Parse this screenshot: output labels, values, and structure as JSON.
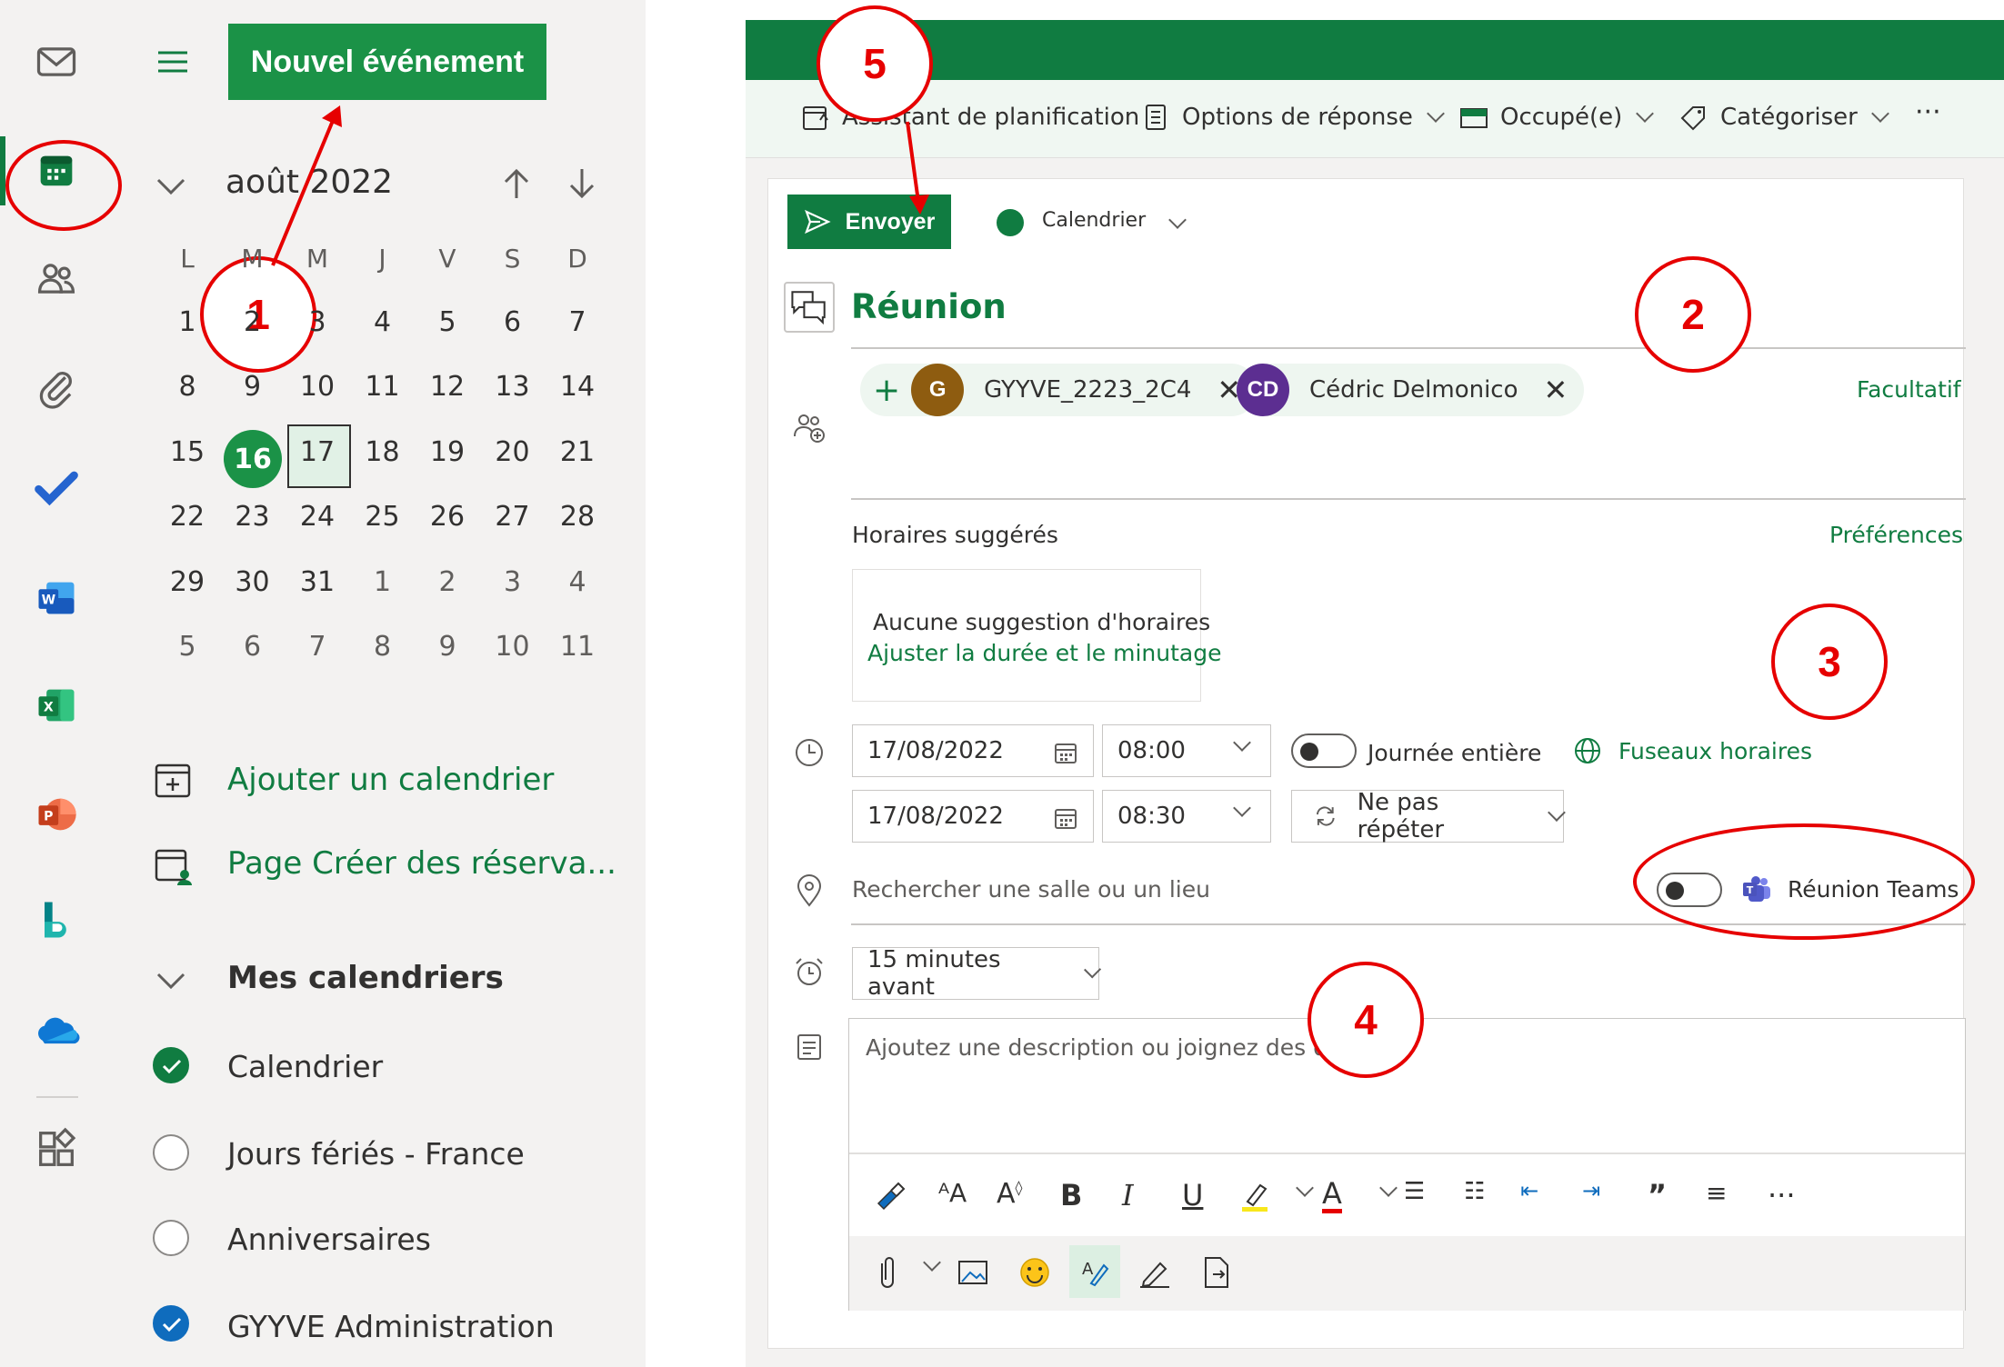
{
  "left_pane": {
    "new_event_label": "Nouvel événement",
    "month_title": "août 2022",
    "weekday_headers": [
      "L",
      "M",
      "M",
      "J",
      "V",
      "S",
      "D"
    ],
    "weeks": [
      [
        "1",
        "2",
        "3",
        "4",
        "5",
        "6",
        "7"
      ],
      [
        "8",
        "9",
        "10",
        "11",
        "12",
        "13",
        "14"
      ],
      [
        "15",
        "16",
        "17",
        "18",
        "19",
        "20",
        "21"
      ],
      [
        "22",
        "23",
        "24",
        "25",
        "26",
        "27",
        "28"
      ],
      [
        "29",
        "30",
        "31",
        "1",
        "2",
        "3",
        "4"
      ],
      [
        "5",
        "6",
        "7",
        "8",
        "9",
        "10",
        "11"
      ]
    ],
    "today": "16",
    "selected_day": "17",
    "add_calendar_label": "Ajouter un calendrier",
    "booking_page_label": "Page Créer des réserva...",
    "my_calendars_label": "Mes calendriers",
    "calendars": [
      {
        "name": "Calendrier",
        "state": "checked-green"
      },
      {
        "name": "Jours fériés - France",
        "state": "unchecked"
      },
      {
        "name": "Anniversaires",
        "state": "unchecked"
      },
      {
        "name": "GYYVE Administration",
        "state": "checked-blue"
      }
    ]
  },
  "toolbar": {
    "scheduling_assistant": "Assistant de planification",
    "response_options": "Options de réponse",
    "busy_status": "Occupé(e)",
    "categorize": "Catégoriser",
    "more": "···"
  },
  "form": {
    "send_label": "Envoyer",
    "calendar_selector": "Calendrier",
    "title_value": "Réunion",
    "attendees": [
      {
        "initials": "G",
        "name": "GYYVE_2223_2C4",
        "color": "#8e5c10"
      },
      {
        "initials": "CD",
        "name": "Cédric Delmonico",
        "color": "#5c2e91"
      }
    ],
    "optional_label": "Facultatif",
    "suggested_times_label": "Horaires suggérés",
    "preferences_label": "Préférences",
    "no_suggestions": "Aucune suggestion d'horaires",
    "adjust_duration": "Ajuster la durée et le minutage",
    "start_date": "17/08/2022",
    "start_time": "08:00",
    "end_date": "17/08/2022",
    "end_time": "08:30",
    "all_day_label": "Journée entière",
    "time_zones_label": "Fuseaux horaires",
    "repeat_label": "Ne pas répéter",
    "location_placeholder": "Rechercher une salle ou un lieu",
    "teams_label": "Réunion Teams",
    "reminder": "15 minutes avant",
    "description_placeholder": "Ajoutez une description ou joignez des do"
  },
  "annotations": [
    "1",
    "2",
    "3",
    "4",
    "5"
  ],
  "colors": {
    "brand": "#107c41",
    "annotation": "#e60000"
  }
}
